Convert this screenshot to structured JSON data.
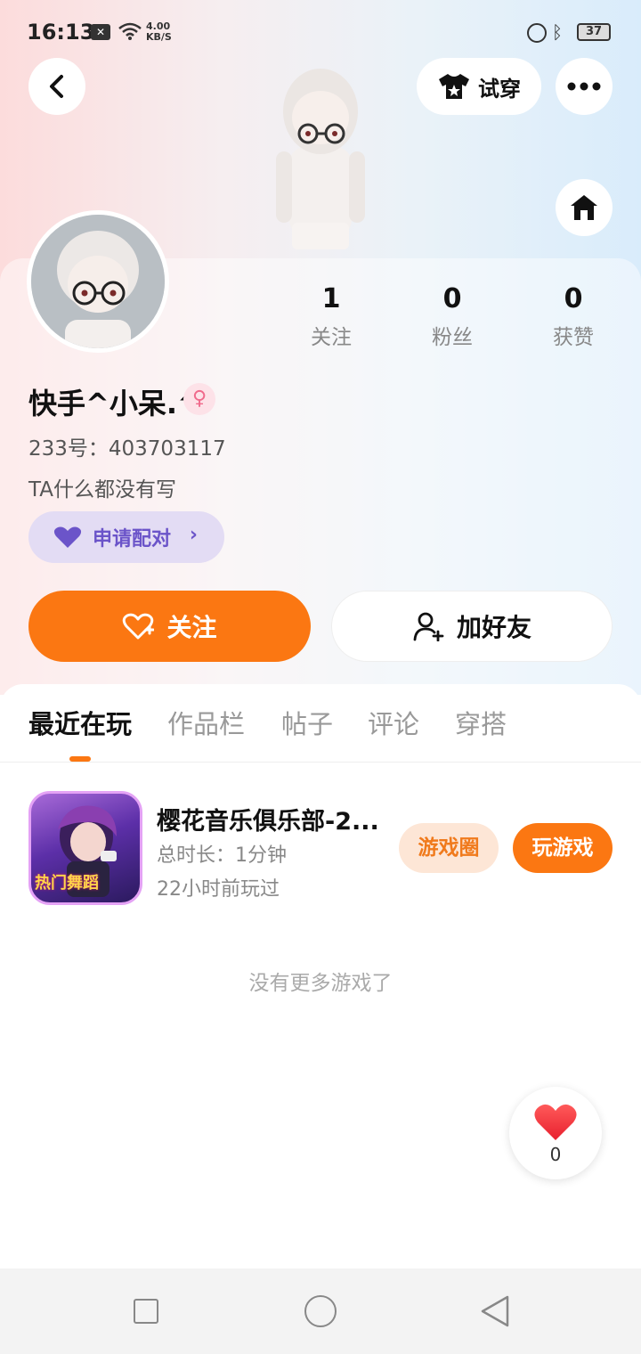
{
  "status_bar": {
    "time": "16:13",
    "net_speed_value": "4.00",
    "net_speed_unit": "KB/S",
    "battery": "37"
  },
  "header": {
    "tryon_label": "试穿"
  },
  "stats": [
    {
      "value": "1",
      "label": "关注"
    },
    {
      "value": "0",
      "label": "粉丝"
    },
    {
      "value": "0",
      "label": "获赞"
    }
  ],
  "profile": {
    "name": "快手^小呆.^",
    "id_text": "233号：403703117",
    "bio": "TA什么都没有写",
    "pair_label": "申请配对"
  },
  "actions": {
    "follow_label": "关注",
    "add_friend_label": "加好友"
  },
  "tabs": [
    {
      "label": "最近在玩",
      "active": true
    },
    {
      "label": "作品栏",
      "active": false
    },
    {
      "label": "帖子",
      "active": false
    },
    {
      "label": "评论",
      "active": false
    },
    {
      "label": "穿搭",
      "active": false
    }
  ],
  "game": {
    "title": "樱花音乐俱乐部-2...",
    "duration": "总时长：1分钟",
    "last_played": "22小时前玩过",
    "circle_label": "游戏圈",
    "play_label": "玩游戏",
    "icon_text": "热门舞蹈"
  },
  "list_end": "没有更多游戏了",
  "like": {
    "count": "0"
  },
  "colors": {
    "accent": "#fb7712",
    "pair_bg": "#e3dcf4",
    "pair_text": "#6b54c9"
  }
}
